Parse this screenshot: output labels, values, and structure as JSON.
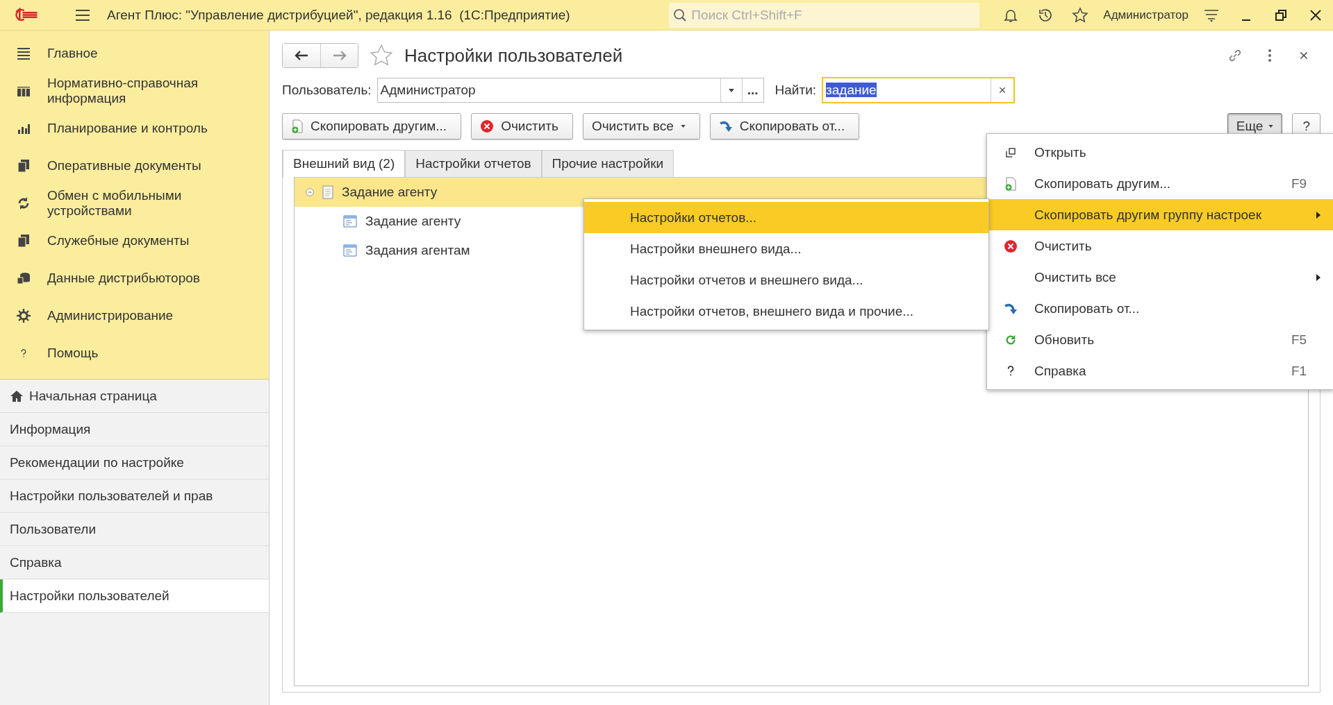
{
  "window": {
    "title": "Агент Плюс: \"Управление дистрибуцией\", редакция 1.16  (1С:Предприятие)",
    "search_placeholder": "Поиск Ctrl+Shift+F",
    "user": "Администратор"
  },
  "sidebar": {
    "sections": [
      {
        "label": "Главное"
      },
      {
        "label": "Нормативно-справочная информация"
      },
      {
        "label": "Планирование и контроль"
      },
      {
        "label": "Оперативные документы"
      },
      {
        "label": "Обмен с мобильными устройствами"
      },
      {
        "label": "Служебные документы"
      },
      {
        "label": "Данные дистрибьюторов"
      },
      {
        "label": "Администрирование"
      },
      {
        "label": "Помощь"
      }
    ],
    "open_pages": [
      {
        "label": "Начальная страница",
        "kind": "home",
        "selected": false
      },
      {
        "label": "Информация",
        "kind": "page",
        "selected": false
      },
      {
        "label": "Рекомендации по настройке",
        "kind": "page",
        "selected": false
      },
      {
        "label": "Настройки пользователей и прав",
        "kind": "page",
        "selected": false
      },
      {
        "label": "Пользователи",
        "kind": "page",
        "selected": false
      },
      {
        "label": "Справка",
        "kind": "page",
        "selected": false
      },
      {
        "label": "Настройки пользователей",
        "kind": "page",
        "selected": true
      }
    ]
  },
  "form": {
    "title": "Настройки пользователей",
    "favorite": false,
    "user_field": {
      "label": "Пользователь:",
      "value": "Администратор",
      "more": "..."
    },
    "find_field": {
      "label": "Найти:",
      "value": "задание",
      "clear": "×"
    },
    "buttons": [
      {
        "label": "Скопировать другим...",
        "dropdown": false
      },
      {
        "label": "Очистить",
        "dropdown": false
      },
      {
        "label": "Очистить все",
        "dropdown": true
      },
      {
        "label": "Скопировать от...",
        "dropdown": false
      }
    ],
    "more_button": {
      "label": "Еще",
      "pressed": true
    },
    "help_button": "?",
    "tabs": [
      {
        "label": "Внешний вид (2)",
        "selected": true
      },
      {
        "label": "Настройки отчетов",
        "selected": false
      },
      {
        "label": "Прочие настройки",
        "selected": false
      }
    ],
    "tree": [
      {
        "label": "Задание агенту",
        "selected": true,
        "expanded": true,
        "children": [
          {
            "label": "Задание агенту",
            "selected": false
          },
          {
            "label": "Задания агентам",
            "selected": false
          }
        ]
      }
    ]
  },
  "context_menu": {
    "items": [
      {
        "label": "Открыть",
        "submenu": false,
        "selected": false
      },
      {
        "label": "Скопировать другим...",
        "shortcut": "F9",
        "submenu": false,
        "selected": false
      },
      {
        "label": "Скопировать другим группу настроек",
        "submenu": true,
        "selected": true
      },
      {
        "label": "Очистить",
        "submenu": false,
        "selected": false
      },
      {
        "label": "Очистить все",
        "submenu": true,
        "selected": false
      },
      {
        "label": "Скопировать от...",
        "submenu": false,
        "selected": false
      },
      {
        "label": "Обновить",
        "shortcut": "F5",
        "submenu": false,
        "selected": false
      },
      {
        "label": "Справка",
        "shortcut": "F1",
        "submenu": false,
        "selected": false
      }
    ],
    "submenu": [
      {
        "label": "Настройки отчетов...",
        "selected": true
      },
      {
        "label": "Настройки внешнего вида...",
        "selected": false
      },
      {
        "label": "Настройки отчетов и внешнего вида...",
        "selected": false
      },
      {
        "label": "Настройки отчетов, внешнего вида и прочие...",
        "selected": false
      }
    ]
  }
}
